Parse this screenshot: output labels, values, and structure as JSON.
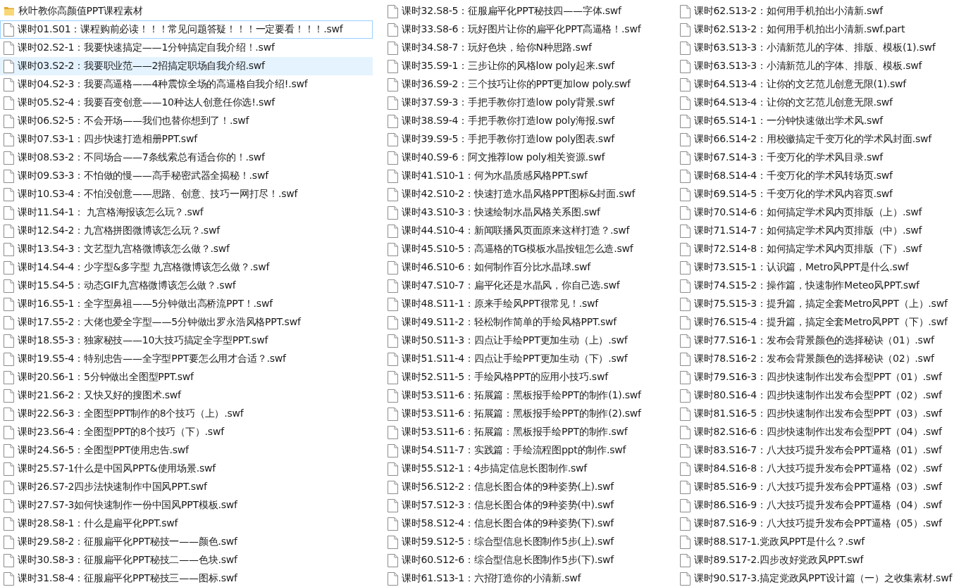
{
  "columns": [
    {
      "items": [
        {
          "kind": "folder",
          "name": "秋叶教你高颜值PPT课程素材",
          "selected": false,
          "focused": false
        },
        {
          "kind": "file",
          "name": "课时01.S01：课程购前必读！！！常见问题答疑！！！一定要看！！！.swf",
          "selected": false,
          "focused": true
        },
        {
          "kind": "file",
          "name": "课时02.S2-1：我要快速搞定——1分钟搞定自我介绍！.swf",
          "selected": false,
          "focused": false
        },
        {
          "kind": "file",
          "name": "课时03.S2-2：我要职业范——2招搞定职场自我介绍.swf",
          "selected": true,
          "focused": false
        },
        {
          "kind": "file",
          "name": "课时04.S2-3：我要高逼格——4种震惊全场的高逼格自我介绍!.swf",
          "selected": false,
          "focused": false
        },
        {
          "kind": "file",
          "name": "课时05.S2-4：我要百变创意——10种达人创意任你选!.swf",
          "selected": false,
          "focused": false
        },
        {
          "kind": "file",
          "name": "课时06.S2-5：不会开场——我们也替你想到了！.swf",
          "selected": false,
          "focused": false
        },
        {
          "kind": "file",
          "name": "课时07.S3-1：四步快速打造相册PPT.swf",
          "selected": false,
          "focused": false
        },
        {
          "kind": "file",
          "name": "课时08.S3-2：不同场合——7条线索总有适合你的！.swf",
          "selected": false,
          "focused": false
        },
        {
          "kind": "file",
          "name": "课时09.S3-3：不怕做的慢——高手秘密武器全揭秘！.swf",
          "selected": false,
          "focused": false
        },
        {
          "kind": "file",
          "name": "课时10.S3-4：不怕没创意——思路、创意、技巧一网打尽！.swf",
          "selected": false,
          "focused": false
        },
        {
          "kind": "file",
          "name": "课时11.S4-1： 九宫格海报该怎么玩？.swf",
          "selected": false,
          "focused": false
        },
        {
          "kind": "file",
          "name": "课时12.S4-2：九宫格拼图微博该怎么玩？.swf",
          "selected": false,
          "focused": false
        },
        {
          "kind": "file",
          "name": "课时13.S4-3：文艺型九宫格微博该怎么做？.swf",
          "selected": false,
          "focused": false
        },
        {
          "kind": "file",
          "name": "课时14.S4-4：少字型&多字型 九宫格微博该怎么做？.swf",
          "selected": false,
          "focused": false
        },
        {
          "kind": "file",
          "name": "课时15.S4-5：动态GIF九宫格微博该怎么做？.swf",
          "selected": false,
          "focused": false
        },
        {
          "kind": "file",
          "name": "课时16.S5-1：全字型鼻祖——5分钟做出高桥流PPT！.swf",
          "selected": false,
          "focused": false
        },
        {
          "kind": "file",
          "name": "课时17.S5-2：大佬也爱全字型——5分钟做出罗永浩风格PPT.swf",
          "selected": false,
          "focused": false
        },
        {
          "kind": "file",
          "name": "课时18.S5-3：独家秘技——10大技巧搞定全字型PPT.swf",
          "selected": false,
          "focused": false
        },
        {
          "kind": "file",
          "name": "课时19.S5-4：特别忠告——全字型PPT要怎么用才合适？.swf",
          "selected": false,
          "focused": false
        },
        {
          "kind": "file",
          "name": "课时20.S6-1：5分钟做出全图型PPT.swf",
          "selected": false,
          "focused": false
        },
        {
          "kind": "file",
          "name": "课时21.S6-2：又快又好的搜图术.swf",
          "selected": false,
          "focused": false
        },
        {
          "kind": "file",
          "name": "课时22.S6-3：全图型PPT制作的8个技巧（上）.swf",
          "selected": false,
          "focused": false
        },
        {
          "kind": "file",
          "name": "课时23.S6-4：全图型PPT的8个技巧（下）.swf",
          "selected": false,
          "focused": false
        },
        {
          "kind": "file",
          "name": "课时24.S6-5：全图型PPT使用忠告.swf",
          "selected": false,
          "focused": false
        },
        {
          "kind": "file",
          "name": "课时25.S7-1什么是中国风PPT&使用场景.swf",
          "selected": false,
          "focused": false
        },
        {
          "kind": "file",
          "name": "课时26.S7-2四步法快速制作中国风PPT.swf",
          "selected": false,
          "focused": false
        },
        {
          "kind": "file",
          "name": "课时27.S7-3如何快速制作一份中国风PPT模板.swf",
          "selected": false,
          "focused": false
        },
        {
          "kind": "file",
          "name": "课时28.S8-1：什么是扁平化PPT.swf",
          "selected": false,
          "focused": false
        },
        {
          "kind": "file",
          "name": "课时29.S8-2：征服扁平化PPT秘技一——颜色.swf",
          "selected": false,
          "focused": false
        },
        {
          "kind": "file",
          "name": "课时30.S8-3：征服扁平化PPT秘技二——色块.swf",
          "selected": false,
          "focused": false
        },
        {
          "kind": "file",
          "name": "课时31.S8-4：征服扁平化PPT秘技三——图标.swf",
          "selected": false,
          "focused": false
        }
      ]
    },
    {
      "items": [
        {
          "kind": "file",
          "name": "课时32.S8-5：征服扁平化PPT秘技四——字体.swf",
          "selected": false,
          "focused": false
        },
        {
          "kind": "file",
          "name": "课时33.S8-6：玩好图片让你的扁平化PPT高逼格！.swf",
          "selected": false,
          "focused": false
        },
        {
          "kind": "file",
          "name": "课时34.S8-7：玩好色块，给你N种思路.swf",
          "selected": false,
          "focused": false
        },
        {
          "kind": "file",
          "name": "课时35.S9-1：三步让你的风格low poly起来.swf",
          "selected": false,
          "focused": false
        },
        {
          "kind": "file",
          "name": "课时36.S9-2：三个技巧让你的PPT更加low poly.swf",
          "selected": false,
          "focused": false
        },
        {
          "kind": "file",
          "name": "课时37.S9-3：手把手教你打造low poly背景.swf",
          "selected": false,
          "focused": false
        },
        {
          "kind": "file",
          "name": "课时38.S9-4：手把手教你打造low poly海报.swf",
          "selected": false,
          "focused": false
        },
        {
          "kind": "file",
          "name": "课时39.S9-5：手把手教你打造low poly图表.swf",
          "selected": false,
          "focused": false
        },
        {
          "kind": "file",
          "name": "课时40.S9-6：阿文推荐low poly相关资源.swf",
          "selected": false,
          "focused": false
        },
        {
          "kind": "file",
          "name": "课时41.S10-1：何为水晶质感风格PPT.swf",
          "selected": false,
          "focused": false
        },
        {
          "kind": "file",
          "name": "课时42.S10-2：快速打造水晶风格PPT图标&封面.swf",
          "selected": false,
          "focused": false
        },
        {
          "kind": "file",
          "name": "课时43.S10-3：快速绘制水晶风格关系图.swf",
          "selected": false,
          "focused": false
        },
        {
          "kind": "file",
          "name": "课时44.S10-4：新闻联播风页面原来这样打造？.swf",
          "selected": false,
          "focused": false
        },
        {
          "kind": "file",
          "name": "课时45.S10-5：高逼格的TG模板水晶按钮怎么造.swf",
          "selected": false,
          "focused": false
        },
        {
          "kind": "file",
          "name": "课时46.S10-6：如何制作百分比水晶球.swf",
          "selected": false,
          "focused": false
        },
        {
          "kind": "file",
          "name": "课时47.S10-7：扁平化还是水晶风，你自己选.swf",
          "selected": false,
          "focused": false
        },
        {
          "kind": "file",
          "name": "课时48.S11-1：原来手绘风PPT很常见！.swf",
          "selected": false,
          "focused": false
        },
        {
          "kind": "file",
          "name": "课时49.S11-2：轻松制作简单的手绘风格PPT.swf",
          "selected": false,
          "focused": false
        },
        {
          "kind": "file",
          "name": "课时50.S11-3：四点让手绘PPT更加生动（上）.swf",
          "selected": false,
          "focused": false
        },
        {
          "kind": "file",
          "name": "课时51.S11-4：四点让手绘PPT更加生动（下）.swf",
          "selected": false,
          "focused": false
        },
        {
          "kind": "file",
          "name": "课时52.S11-5：手绘风格PPT的应用小技巧.swf",
          "selected": false,
          "focused": false
        },
        {
          "kind": "file",
          "name": "课时53.S11-6：拓展篇：黑板报手绘PPT的制作(1).swf",
          "selected": false,
          "focused": false
        },
        {
          "kind": "file",
          "name": "课时53.S11-6：拓展篇：黑板报手绘PPT的制作(2).swf",
          "selected": false,
          "focused": false
        },
        {
          "kind": "file",
          "name": "课时53.S11-6：拓展篇：黑板报手绘PPT的制作.swf",
          "selected": false,
          "focused": false
        },
        {
          "kind": "file",
          "name": "课时54.S11-7：实践篇：手绘流程图ppt的制作.swf",
          "selected": false,
          "focused": false
        },
        {
          "kind": "file",
          "name": "课时55.S12-1：4步搞定信息长图制作.swf",
          "selected": false,
          "focused": false
        },
        {
          "kind": "file",
          "name": "课时56.S12-2：信息长图合体的9种姿势(上).swf",
          "selected": false,
          "focused": false
        },
        {
          "kind": "file",
          "name": "课时57.S12-3：信息长图合体的9种姿势(中).swf",
          "selected": false,
          "focused": false
        },
        {
          "kind": "file",
          "name": "课时58.S12-4：信息长图合体的9种姿势(下).swf",
          "selected": false,
          "focused": false
        },
        {
          "kind": "file",
          "name": "课时59.S12-5：综合型信息长图制作5步(上).swf",
          "selected": false,
          "focused": false
        },
        {
          "kind": "file",
          "name": "课时60.S12-6：综合型信息长图制作5步(下).swf",
          "selected": false,
          "focused": false
        },
        {
          "kind": "file",
          "name": "课时61.S13-1：六招打造你的小清新.swf",
          "selected": false,
          "focused": false
        }
      ]
    },
    {
      "items": [
        {
          "kind": "file",
          "name": "课时62.S13-2：如何用手机拍出小清新.swf",
          "selected": false,
          "focused": false
        },
        {
          "kind": "file",
          "name": "课时62.S13-2：如何用手机拍出小清新.swf.part",
          "selected": false,
          "focused": false
        },
        {
          "kind": "file",
          "name": "课时63.S13-3：小清新范儿的字体、排版、模板(1).swf",
          "selected": false,
          "focused": false
        },
        {
          "kind": "file",
          "name": "课时63.S13-3：小清新范儿的字体、排版、模板.swf",
          "selected": false,
          "focused": false
        },
        {
          "kind": "file",
          "name": "课时64.S13-4：让你的文艺范儿创意无限(1).swf",
          "selected": false,
          "focused": false
        },
        {
          "kind": "file",
          "name": "课时64.S13-4：让你的文艺范儿创意无限.swf",
          "selected": false,
          "focused": false
        },
        {
          "kind": "file",
          "name": "课时65.S14-1：一分钟快速做出学术风.swf",
          "selected": false,
          "focused": false
        },
        {
          "kind": "file",
          "name": "课时66.S14-2：用校徽搞定千变万化的学术风封面.swf",
          "selected": false,
          "focused": false
        },
        {
          "kind": "file",
          "name": "课时67.S14-3：千变万化的学术风目录.swf",
          "selected": false,
          "focused": false
        },
        {
          "kind": "file",
          "name": "课时68.S14-4：千变万化的学术风转场页.swf",
          "selected": false,
          "focused": false
        },
        {
          "kind": "file",
          "name": "课时69.S14-5：千变万化的学术风内容页.swf",
          "selected": false,
          "focused": false
        },
        {
          "kind": "file",
          "name": "课时70.S14-6：如何搞定学术风内页排版（上）.swf",
          "selected": false,
          "focused": false
        },
        {
          "kind": "file",
          "name": "课时71.S14-7：如何搞定学术风内页排版（中）.swf",
          "selected": false,
          "focused": false
        },
        {
          "kind": "file",
          "name": "课时72.S14-8：如何搞定学术风内页排版（下）.swf",
          "selected": false,
          "focused": false
        },
        {
          "kind": "file",
          "name": "课时73.S15-1：认识篇，Metro风PPT是什么.swf",
          "selected": false,
          "focused": false
        },
        {
          "kind": "file",
          "name": "课时74.S15-2：操作篇，快速制作Meteo风PPT.swf",
          "selected": false,
          "focused": false
        },
        {
          "kind": "file",
          "name": "课时75.S15-3：提升篇，搞定全套Metro风PPT（上）.swf",
          "selected": false,
          "focused": false
        },
        {
          "kind": "file",
          "name": "课时76.S15-4：提升篇，搞定全套Metro风PPT（下）.swf",
          "selected": false,
          "focused": false
        },
        {
          "kind": "file",
          "name": "课时77.S16-1：发布会背景颜色的选择秘诀（01）.swf",
          "selected": false,
          "focused": false
        },
        {
          "kind": "file",
          "name": "课时78.S16-2：发布会背景颜色的选择秘诀（02）.swf",
          "selected": false,
          "focused": false
        },
        {
          "kind": "file",
          "name": "课时79.S16-3：四步快速制作出发布会型PPT（01）.swf",
          "selected": false,
          "focused": false
        },
        {
          "kind": "file",
          "name": "课时80.S16-4：四步快速制作出发布会型PPT（02）.swf",
          "selected": false,
          "focused": false
        },
        {
          "kind": "file",
          "name": "课时81.S16-5：四步快速制作出发布会型PPT（03）.swf",
          "selected": false,
          "focused": false
        },
        {
          "kind": "file",
          "name": "课时82.S16-6：四步快速制作出发布会型PPT（04）.swf",
          "selected": false,
          "focused": false
        },
        {
          "kind": "file",
          "name": "课时83.S16-7：八大技巧提升发布会PPT逼格（01）.swf",
          "selected": false,
          "focused": false
        },
        {
          "kind": "file",
          "name": "课时84.S16-8：八大技巧提升发布会PPT逼格（02）.swf",
          "selected": false,
          "focused": false
        },
        {
          "kind": "file",
          "name": "课时85.S16-9：八大技巧提升发布会PPT逼格（03）.swf",
          "selected": false,
          "focused": false
        },
        {
          "kind": "file",
          "name": "课时86.S16-9：八大技巧提升发布会PPT逼格（04）.swf",
          "selected": false,
          "focused": false
        },
        {
          "kind": "file",
          "name": "课时87.S16-9：八大技巧提升发布会PPT逼格（05）.swf",
          "selected": false,
          "focused": false
        },
        {
          "kind": "file",
          "name": "课时88.S17-1.党政风PPT是什么？.swf",
          "selected": false,
          "focused": false
        },
        {
          "kind": "file",
          "name": "课时89.S17-2.四步改好党政风PPT.swf",
          "selected": false,
          "focused": false
        },
        {
          "kind": "file",
          "name": "课时90.S17-3.搞定党政风PPT设计篇（一）之收集素材.swf",
          "selected": false,
          "focused": false
        }
      ]
    }
  ]
}
